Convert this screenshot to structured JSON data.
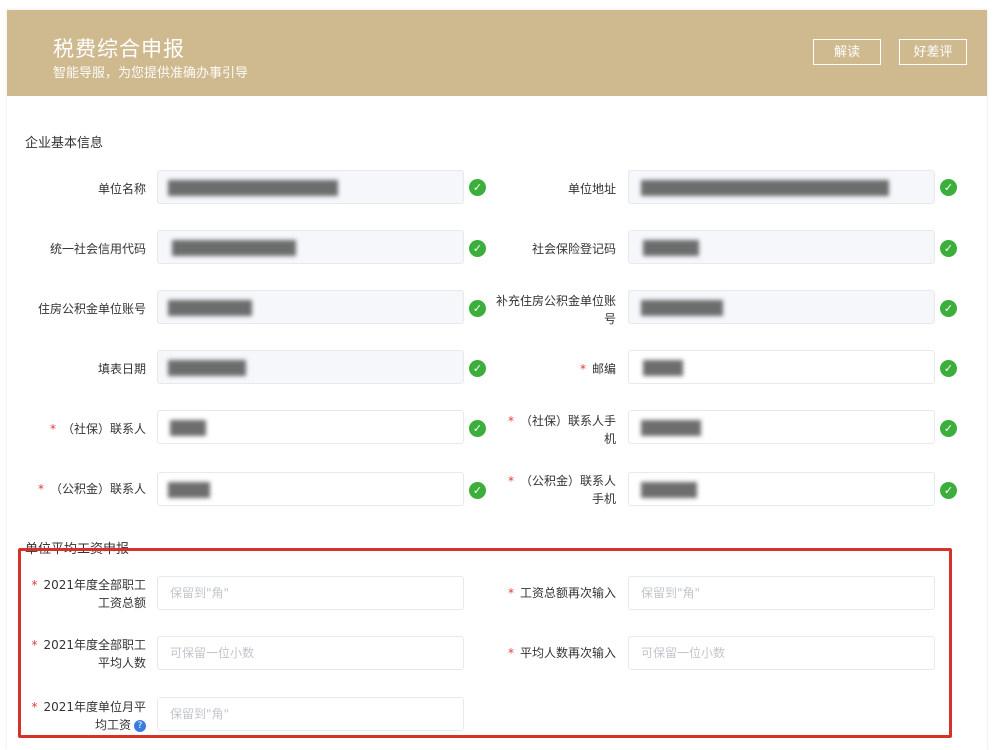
{
  "header": {
    "title": "税费综合申报",
    "subtitle": "智能导服，为您提供准确办事引导",
    "btn_interpret": "解读",
    "btn_rate": "好差评"
  },
  "basic_info": {
    "title": "企业基本信息",
    "fields": {
      "unit_name": "单位名称",
      "unit_address": "单位地址",
      "credit_code": "统一社会信用代码",
      "social_insurance_code": "社会保险登记码",
      "housing_fund_account": "住房公积金单位账号",
      "supp_housing_fund_account_l1": "补充住房公积金单位账",
      "supp_housing_fund_account_l2": "号",
      "fill_date": "填表日期",
      "postcode": "邮编",
      "si_contact": "（社保）联系人",
      "si_contact_phone_l1": "（社保）联系人手",
      "si_contact_phone_l2": "机",
      "hf_contact": "（公积金）联系人",
      "hf_contact_phone_l1": "（公积金）联系人",
      "hf_contact_phone_l2": "手机"
    },
    "required_mark": "*",
    "check_mark": "✓"
  },
  "wage_report": {
    "title": "单位平均工资申报",
    "total_wage_l1": "2021年度全部职工",
    "total_wage_l2": "工资总额",
    "total_wage_confirm": "工资总额再次输入",
    "avg_count_l1": "2021年度全部职工",
    "avg_count_l2": "平均人数",
    "avg_count_confirm": "平均人数再次输入",
    "monthly_avg_l1": "2021年度单位月平",
    "monthly_avg_l2": "均工资",
    "placeholder_jiao": "保留到\"角\"",
    "placeholder_decimal": "可保留一位小数",
    "help_icon": "?"
  },
  "colors": {
    "header_bg": "#cfb98f",
    "check_green": "#3cae3c",
    "required_red": "#e03c3c",
    "highlight_red": "#d6322a"
  }
}
